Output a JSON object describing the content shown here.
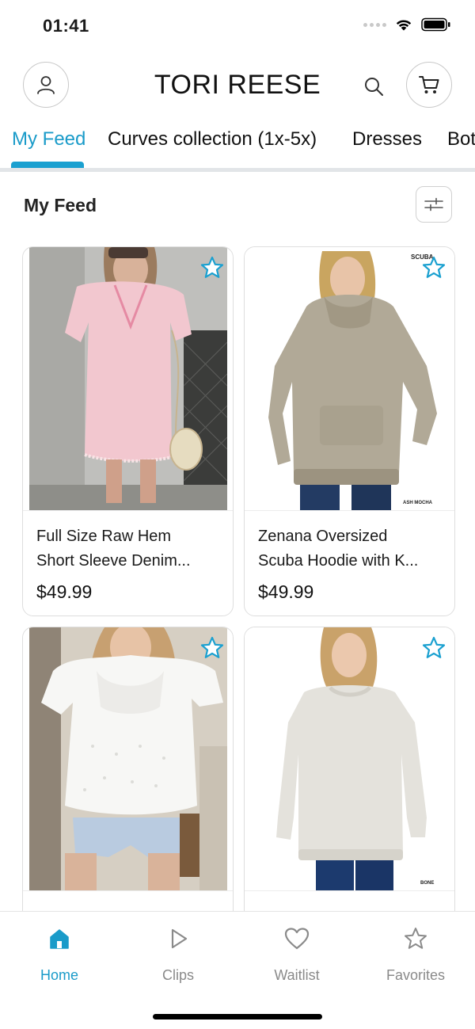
{
  "status": {
    "time": "01:41"
  },
  "header": {
    "brand": "TORI REESE"
  },
  "tabs": [
    {
      "label": "My Feed",
      "active": true
    },
    {
      "label": "Curves collection (1x-5x)",
      "active": false
    },
    {
      "label": "Dresses",
      "active": false
    },
    {
      "label": "Bot",
      "active": false
    }
  ],
  "feed": {
    "title": "My Feed"
  },
  "products": [
    {
      "name_line1": "Full Size Raw Hem",
      "name_line2": "Short Sleeve Denim...",
      "price": "$49.99",
      "image_icon": "pink-denim-dress-photo"
    },
    {
      "name_line1": "Zenana Oversized",
      "name_line2": "Scuba Hoodie with K...",
      "price": "$49.99",
      "image_icon": "mocha-hoodie-photo",
      "tag_top": "SCUBA",
      "tag_bottom": "ASH MOCHA"
    },
    {
      "name_line1": "",
      "name_line2": "",
      "price": "",
      "image_icon": "white-eyelet-top-photo"
    },
    {
      "name_line1": "",
      "name_line2": "",
      "price": "",
      "image_icon": "bone-sweatshirt-photo",
      "tag_bottom": "BONE"
    }
  ],
  "bottom_nav": [
    {
      "label": "Home",
      "icon": "home-icon",
      "active": true
    },
    {
      "label": "Clips",
      "icon": "play-icon",
      "active": false
    },
    {
      "label": "Waitlist",
      "icon": "heart-icon",
      "active": false
    },
    {
      "label": "Favorites",
      "icon": "star-icon",
      "active": false
    }
  ],
  "colors": {
    "accent": "#1a9bc9",
    "star": "#1aa0d0",
    "inactive": "#8a8a8a"
  }
}
